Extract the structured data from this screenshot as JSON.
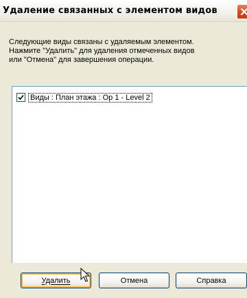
{
  "window": {
    "title": "Удаление связанных с элементом видов"
  },
  "message": "Следующие виды связаны с удаляемым элементом.\nНажмите \"Удалить\" для удаления отмеченных видов\nили \"Отмена\" для завершения операции.",
  "list": {
    "items": [
      {
        "label": "Виды : План этажа : Op 1 - Level 2",
        "checked": true
      }
    ]
  },
  "buttons": {
    "delete": "Удалить",
    "cancel": "Отмена",
    "help": "Справка"
  },
  "icons": {
    "close": "close-icon",
    "check": "checkmark-icon",
    "cursor": "mouse-pointer-icon"
  },
  "colors": {
    "title_bar": "#f3f2ec",
    "close_button": "#d54624",
    "dialog_background": "#ece9d8",
    "default_button_focus": "#f9b747",
    "list_border": "#7f9db9"
  }
}
